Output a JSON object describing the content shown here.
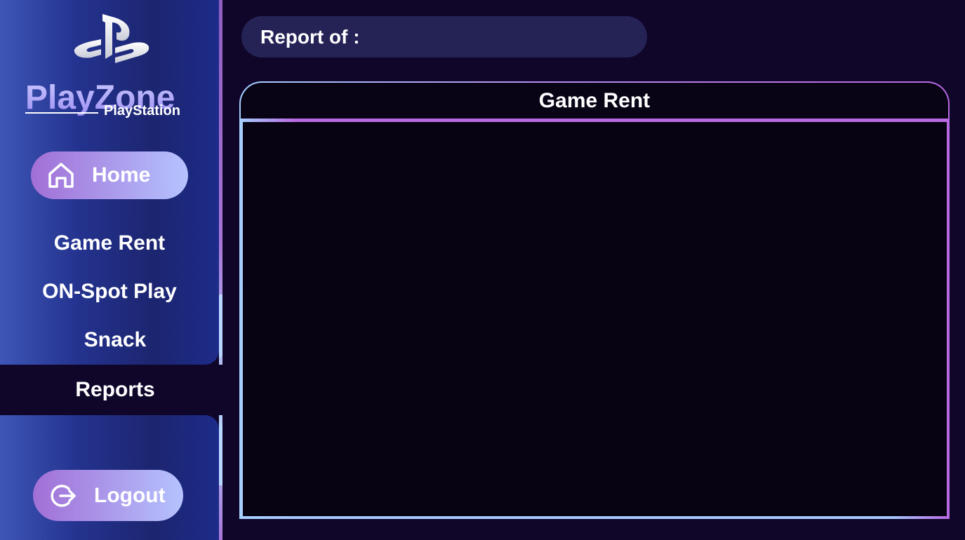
{
  "brand": {
    "name": "PlayZone",
    "subtitle": "PlayStation"
  },
  "sidebar": {
    "home_label": "Home",
    "items": [
      {
        "label": "Game Rent"
      },
      {
        "label": "ON-Spot Play"
      },
      {
        "label": "Snack"
      },
      {
        "label": "Reports",
        "active": true
      }
    ],
    "logout_label": "Logout"
  },
  "header": {
    "report_label": "Report of :"
  },
  "panel": {
    "title": "Game Rent"
  },
  "colors": {
    "background": "#10062a",
    "sidebar": "#1c256f",
    "accent_purple": "#b868e0",
    "accent_blue": "#a6d0ff"
  },
  "icons": {
    "logo": "playstation-logo-icon",
    "home": "home-icon",
    "logout": "logout-icon"
  }
}
